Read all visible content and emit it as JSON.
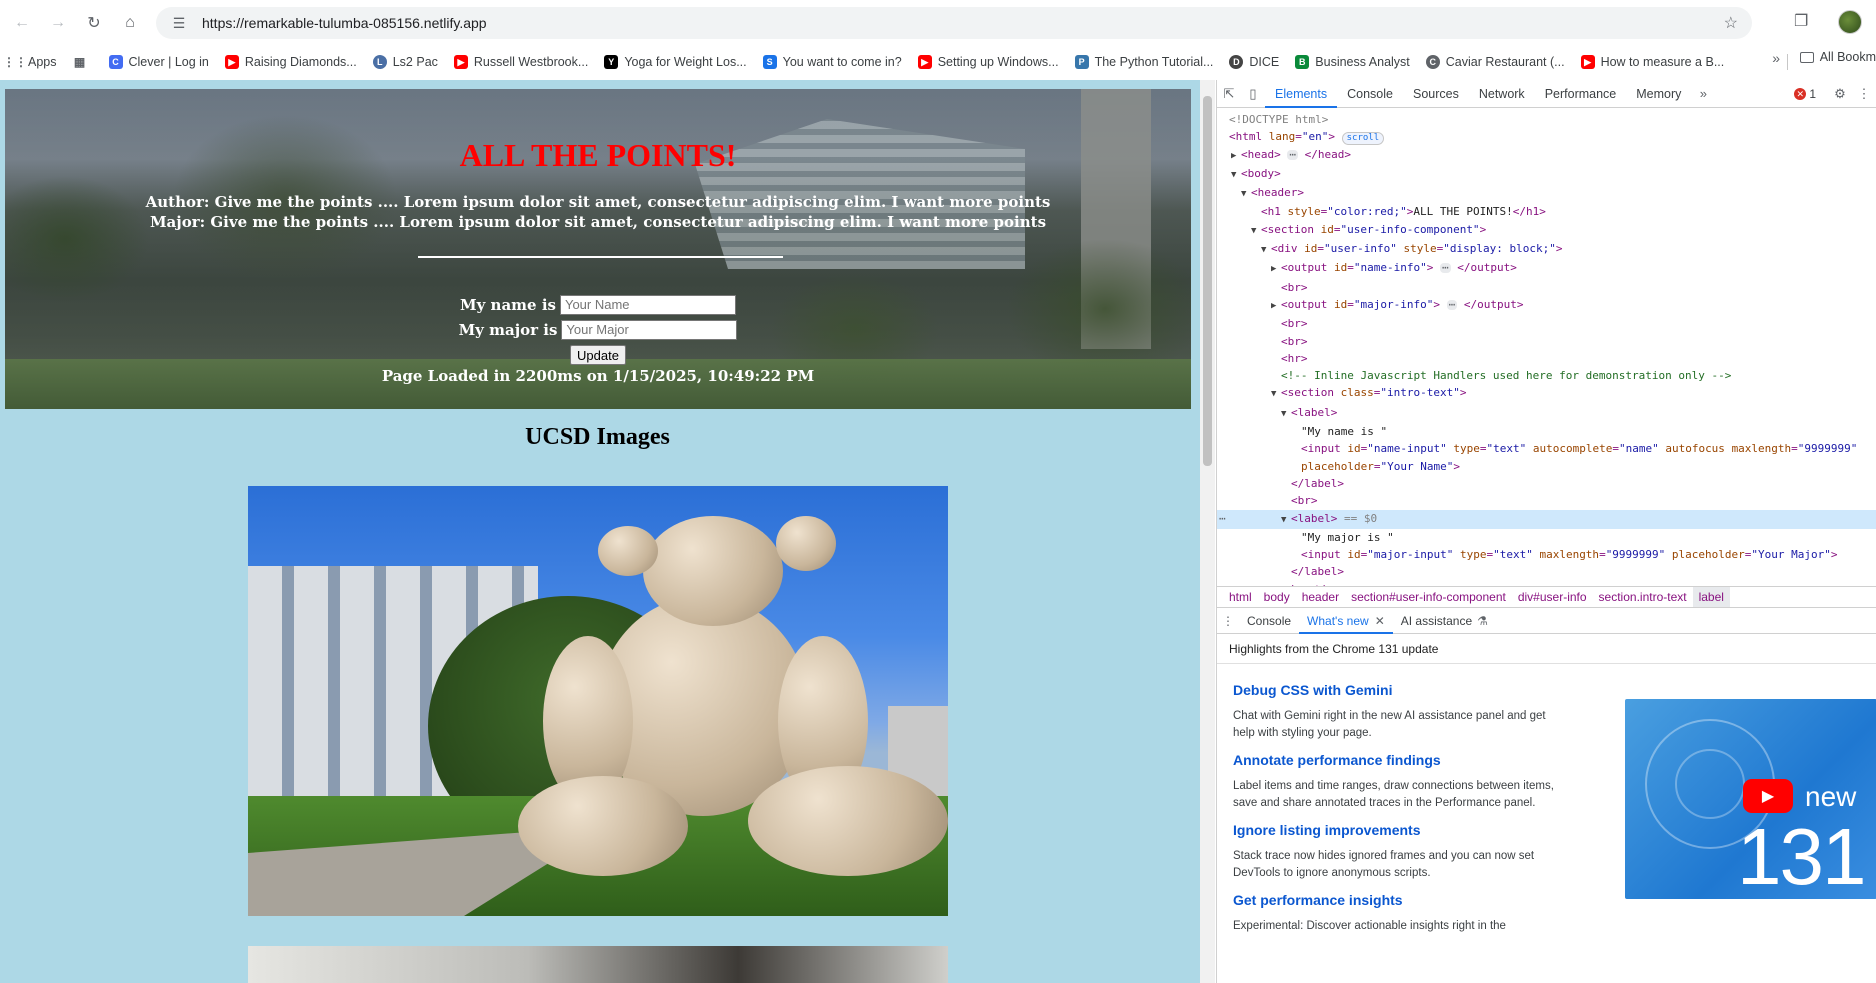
{
  "browser": {
    "url": "https://remarkable-tulumba-085156.netlify.app",
    "bookmarks": [
      {
        "label": "Apps",
        "icon": "apps-grid-icon",
        "color": "#5f6368"
      },
      {
        "label": "",
        "icon": "grid-icon",
        "color": "#5f6368"
      },
      {
        "label": "Clever | Log in",
        "icon": "clever-icon",
        "color": "#436cf2"
      },
      {
        "label": "Raising Diamonds...",
        "icon": "youtube-icon",
        "color": "#ff0000"
      },
      {
        "label": "Ls2 Pac",
        "icon": "ls2pac-icon",
        "color": "#4a6fa5"
      },
      {
        "label": "Russell Westbrook...",
        "icon": "youtube-icon",
        "color": "#ff0000"
      },
      {
        "label": "Yoga for Weight Los...",
        "icon": "yoga-icon",
        "color": "#000000"
      },
      {
        "label": "You want to come in?",
        "icon": "s-icon",
        "color": "#1a73e8"
      },
      {
        "label": "Setting up Windows...",
        "icon": "youtube-icon",
        "color": "#ff0000"
      },
      {
        "label": "The Python Tutorial...",
        "icon": "python-icon",
        "color": "#3776ab"
      },
      {
        "label": "DICE",
        "icon": "dice-icon",
        "color": "#444444"
      },
      {
        "label": "Business Analyst",
        "icon": "business-icon",
        "color": "#0a8a3a"
      },
      {
        "label": "Caviar Restaurant (...",
        "icon": "caviar-icon",
        "color": "#5f6368"
      },
      {
        "label": "How to measure a B...",
        "icon": "youtube-icon",
        "color": "#ff0000"
      }
    ],
    "all_bookmarks": "All Bookm"
  },
  "page": {
    "title": "ALL THE POINTS!",
    "author_line": "Author: Give me the points .... Lorem ipsum dolor sit amet, consectetur adipiscing elim. I want more points",
    "major_line": "Major: Give me the points .... Lorem ipsum dolor sit amet, consectetur adipiscing elim. I want more points",
    "name_label": "My name is",
    "name_placeholder": "Your Name",
    "major_label": "My major is",
    "major_placeholder": "Your Major",
    "update_label": "Update",
    "loaded_text": "Page Loaded in 2200ms on 1/15/2025, 10:49:22 PM",
    "section_title": "UCSD Images"
  },
  "devtools": {
    "tabs": [
      "Elements",
      "Console",
      "Sources",
      "Network",
      "Performance",
      "Memory"
    ],
    "error_count": "1",
    "breadcrumbs": [
      "html",
      "body",
      "header",
      "section#user-info-component",
      "div#user-info",
      "section.intro-text",
      "label"
    ],
    "drawer_tabs": [
      "Console",
      "What's new",
      "AI assistance"
    ],
    "whats_new_header": "Highlights from the Chrome 131 update",
    "whats_new": [
      {
        "title": "Debug CSS with Gemini",
        "desc": "Chat with Gemini right in the new AI assistance panel and get help with styling your page."
      },
      {
        "title": "Annotate performance findings",
        "desc": "Label items and time ranges, draw connections between items, save and share annotated traces in the Performance panel."
      },
      {
        "title": "Ignore listing improvements",
        "desc": "Stack trace now hides ignored frames and you can now set DevTools to ignore anonymous scripts."
      },
      {
        "title": "Get performance insights",
        "desc": "Experimental: Discover actionable insights right in the"
      }
    ],
    "video_new": "new",
    "video_version": "131"
  }
}
